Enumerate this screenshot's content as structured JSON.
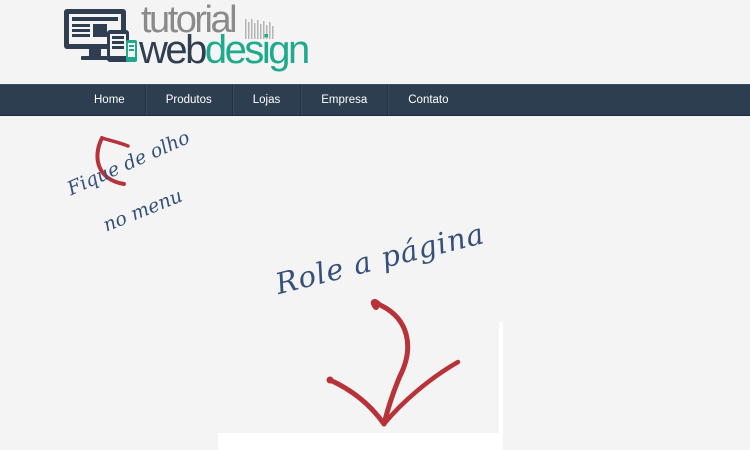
{
  "logo": {
    "line1": "tutorial",
    "line2_web": "web",
    "line2_design": "design",
    "icon": "devices-icon"
  },
  "nav": {
    "items": [
      {
        "label": "Home"
      },
      {
        "label": "Produtos"
      },
      {
        "label": "Lojas"
      },
      {
        "label": "Empresa"
      },
      {
        "label": "Contato"
      }
    ]
  },
  "annotations": {
    "menu_hint_line1": "Fique de olho",
    "menu_hint_line2": "no menu",
    "scroll_hint": "Role a página"
  },
  "colors": {
    "nav_bg": "#2c3e50",
    "accent_red": "#b8323a",
    "handwriting_blue": "#35507a",
    "logo_green": "#1eaa8c",
    "logo_dark": "#2f3e50",
    "logo_gray": "#8a8a8a"
  }
}
